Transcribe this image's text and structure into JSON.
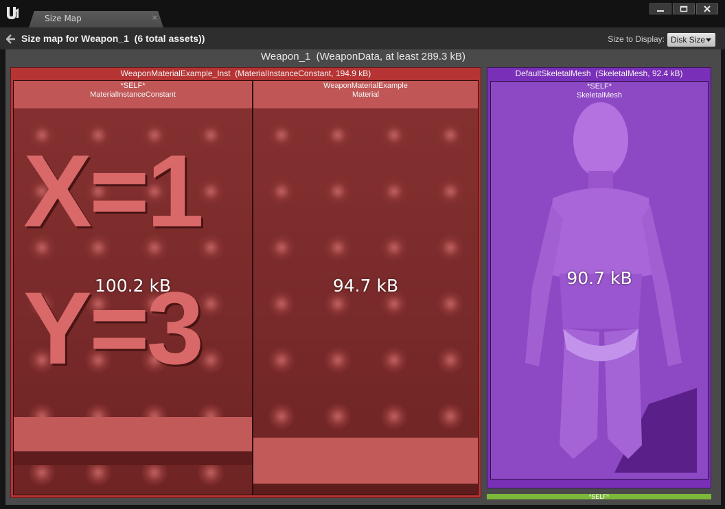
{
  "window": {
    "tab_title": "Size Map",
    "tab_close": "×"
  },
  "toolbar": {
    "title": "Size map for Weapon_1  (6 total assets))",
    "size_to_display_label": "Size to Display:",
    "size_to_display_value": "Disk Size"
  },
  "treemap": {
    "root_label": "Weapon_1  (WeaponData, at least 289.3 kB)",
    "groups": [
      {
        "label": "WeaponMaterialExample_Inst  (MaterialInstanceConstant, 194.9 kB)",
        "color": "#b63434",
        "cells": [
          {
            "line1": "*SELF*",
            "line2": "MaterialInstanceConstant",
            "size": "100.2 kB",
            "thumb_text_1": "X=1",
            "thumb_text_2": "Y=3"
          },
          {
            "line1": "WeaponMaterialExample",
            "line2": "Material",
            "size": "94.7 kB"
          }
        ]
      },
      {
        "label": "DefaultSkeletalMesh  (SkeletalMesh, 92.4 kB)",
        "color": "#7a2fb8",
        "cells": [
          {
            "line1": "*SELF*",
            "line2": "SkeletalMesh",
            "size": "90.7 kB"
          }
        ]
      },
      {
        "label": "*SELF*",
        "color": "#7cb83a"
      }
    ]
  },
  "icons": {
    "logo": "unreal-logo-icon",
    "back": "back-arrow-icon",
    "minimize": "minimize-icon",
    "maximize": "maximize-icon",
    "close": "close-icon"
  }
}
